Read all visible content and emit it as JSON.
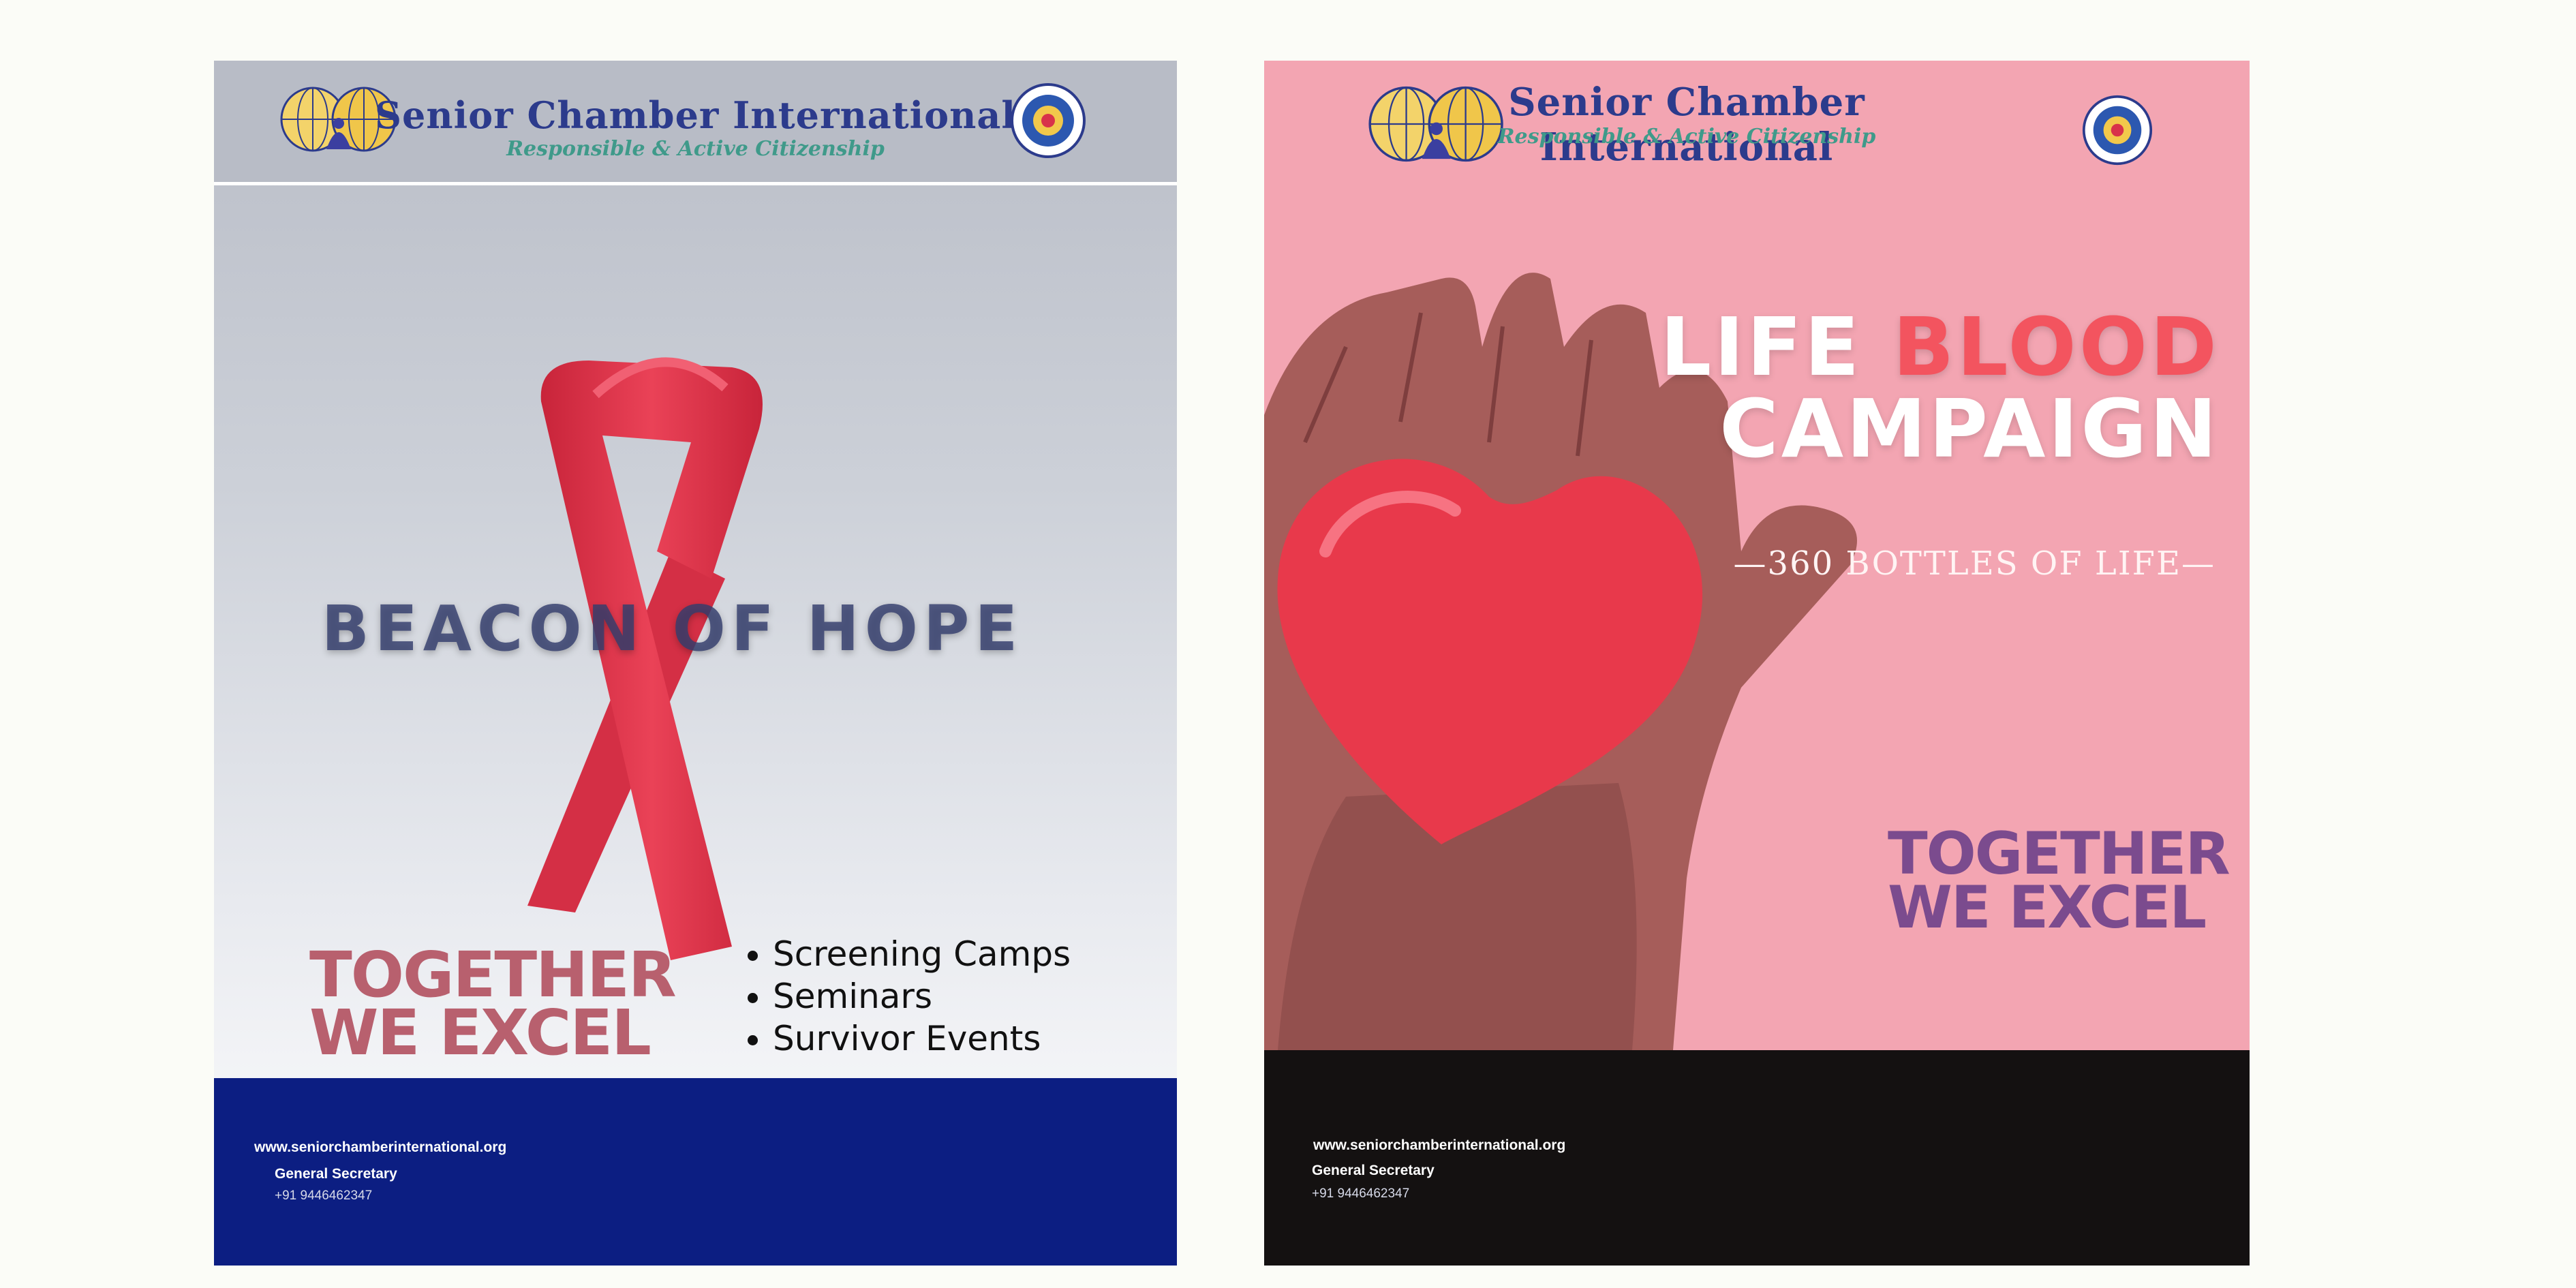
{
  "poster_left": {
    "header": {
      "title": "Senior Chamber International",
      "tagline": "Responsible & Active Citizenship",
      "logo_icons": [
        "globe-logo-icon",
        "seal-logo-icon"
      ]
    },
    "headline": "BEACON OF HOPE",
    "slogan": {
      "line1": "TOGETHER",
      "line2": "WE EXCEL"
    },
    "bullets": [
      "Screening Camps",
      "Seminars",
      "Survivor Events"
    ],
    "footer": {
      "url": "www.seniorchamberinternational.org",
      "role": "General Secretary",
      "phone": "+91 9446462347"
    },
    "colors": {
      "footer": "#0c1e82",
      "ribbon": "#e0304a",
      "slogan": "#b8606e"
    }
  },
  "poster_right": {
    "header": {
      "title": "Senior Chamber International",
      "tagline": "Responsible & Active Citizenship",
      "logo_icons": [
        "globe-logo-icon",
        "seal-logo-icon"
      ]
    },
    "headline": {
      "word1": "LIFE",
      "word2": "BLOOD",
      "word3": "CAMPAIGN"
    },
    "subheadline": "—360 BOTTLES OF LIFE—",
    "slogan": {
      "line1": "TOGETHER",
      "line2": "WE EXCEL"
    },
    "footer": {
      "url": "www.seniorchamberinternational.org",
      "role": "General Secretary",
      "phone": "+91 9446462347"
    },
    "colors": {
      "background": "#f3a5b2",
      "footer": "#141111",
      "heart": "#e8394b",
      "slogan": "#7b4b8e"
    }
  }
}
